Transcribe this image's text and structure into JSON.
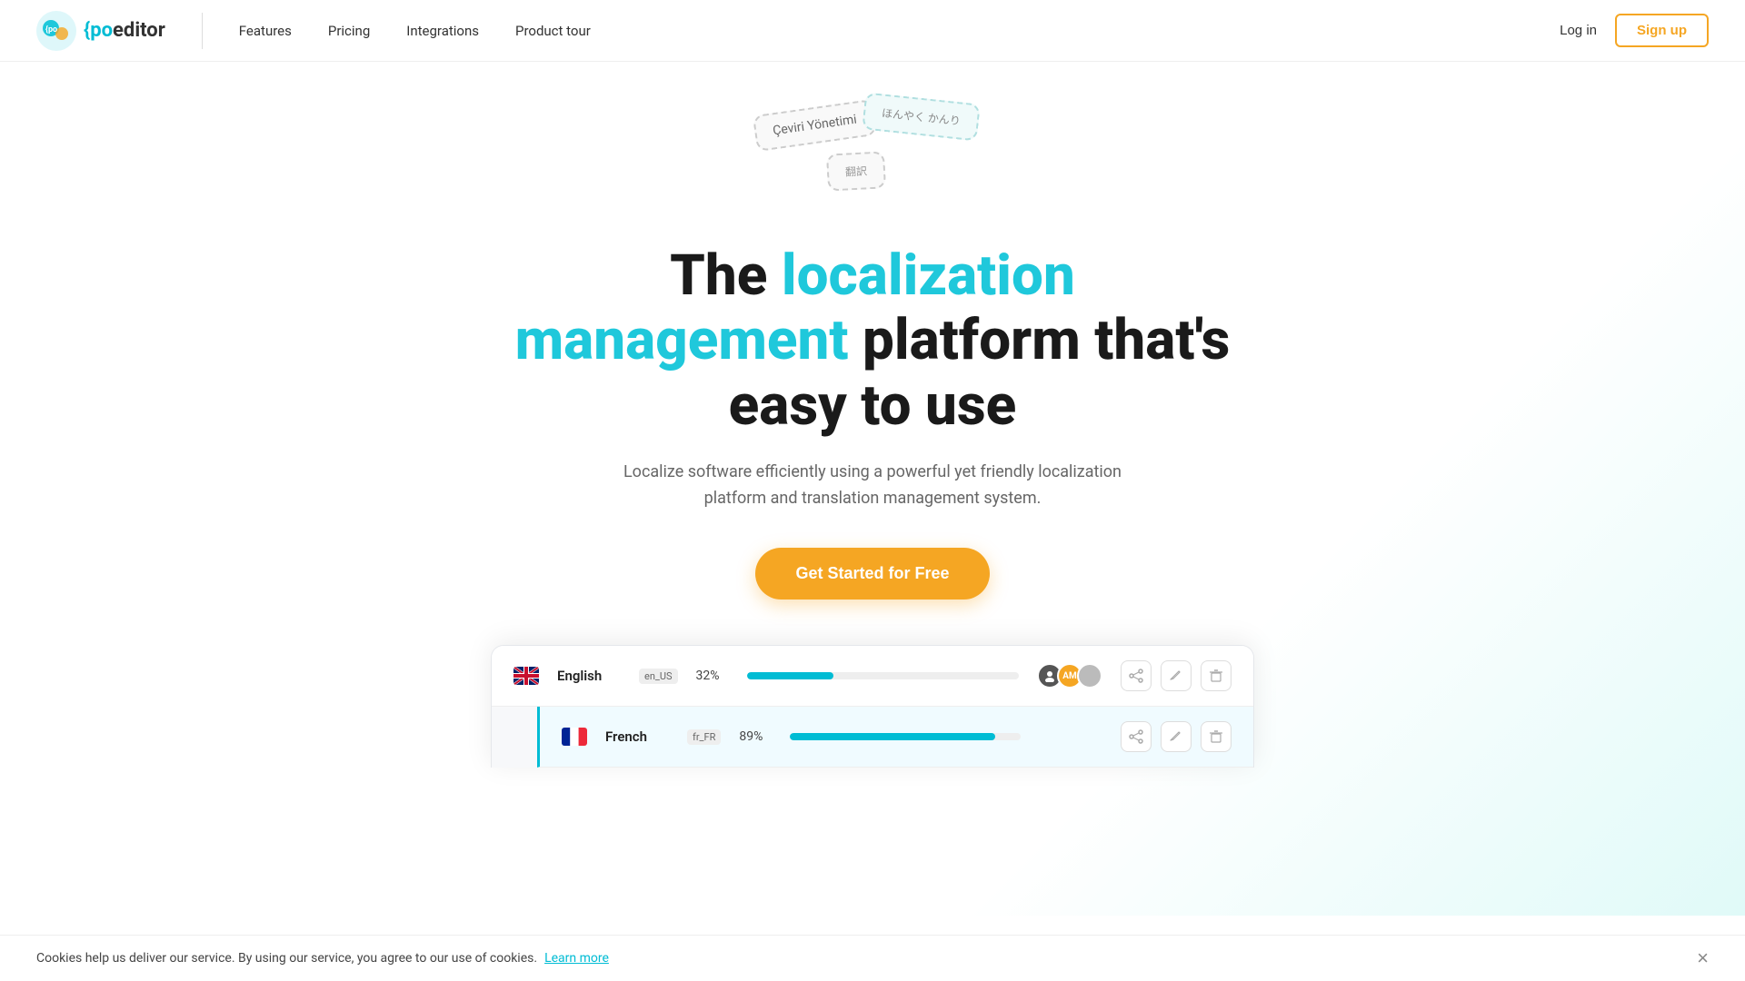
{
  "brand": {
    "logo_po": "{po",
    "logo_editor": "editor",
    "logo_bracket": "}"
  },
  "navbar": {
    "links": [
      {
        "label": "Features",
        "id": "features"
      },
      {
        "label": "Pricing",
        "id": "pricing"
      },
      {
        "label": "Integrations",
        "id": "integrations"
      },
      {
        "label": "Product tour",
        "id": "product-tour"
      }
    ],
    "login_label": "Log in",
    "signup_label": "Sign up"
  },
  "hero": {
    "bubble1_text": "Çeviri Yönetimi",
    "bubble2_text": "ほんやく かんり",
    "bubble3_text": "翻訳",
    "title_part1": "The ",
    "title_cyan1": "localization",
    "title_part2": " ",
    "title_cyan2": "management",
    "title_part3": " platform that's",
    "title_part4": "easy to use",
    "subtitle": "Localize software efficiently using a powerful yet friendly localization platform and translation management system.",
    "cta_label": "Get Started for Free"
  },
  "dashboard": {
    "rows": [
      {
        "lang": "English",
        "code": "en_US",
        "pct": "32%",
        "pct_num": 32,
        "avatars": [
          {
            "color": "#555",
            "initials": ""
          },
          {
            "color": "#f5a623",
            "initials": "AM"
          },
          {
            "color": "#ccc",
            "initials": ""
          }
        ],
        "actions": [
          "share",
          "edit",
          "delete"
        ]
      },
      {
        "lang": "French",
        "code": "fr_FR",
        "pct": "89%",
        "pct_num": 89,
        "avatars": [],
        "actions": [
          "share",
          "edit",
          "delete"
        ]
      }
    ]
  },
  "cookie": {
    "text": "Cookies help us deliver our service. By using our service, you agree to our use of cookies.",
    "link_label": "Learn more",
    "close_label": "×"
  }
}
